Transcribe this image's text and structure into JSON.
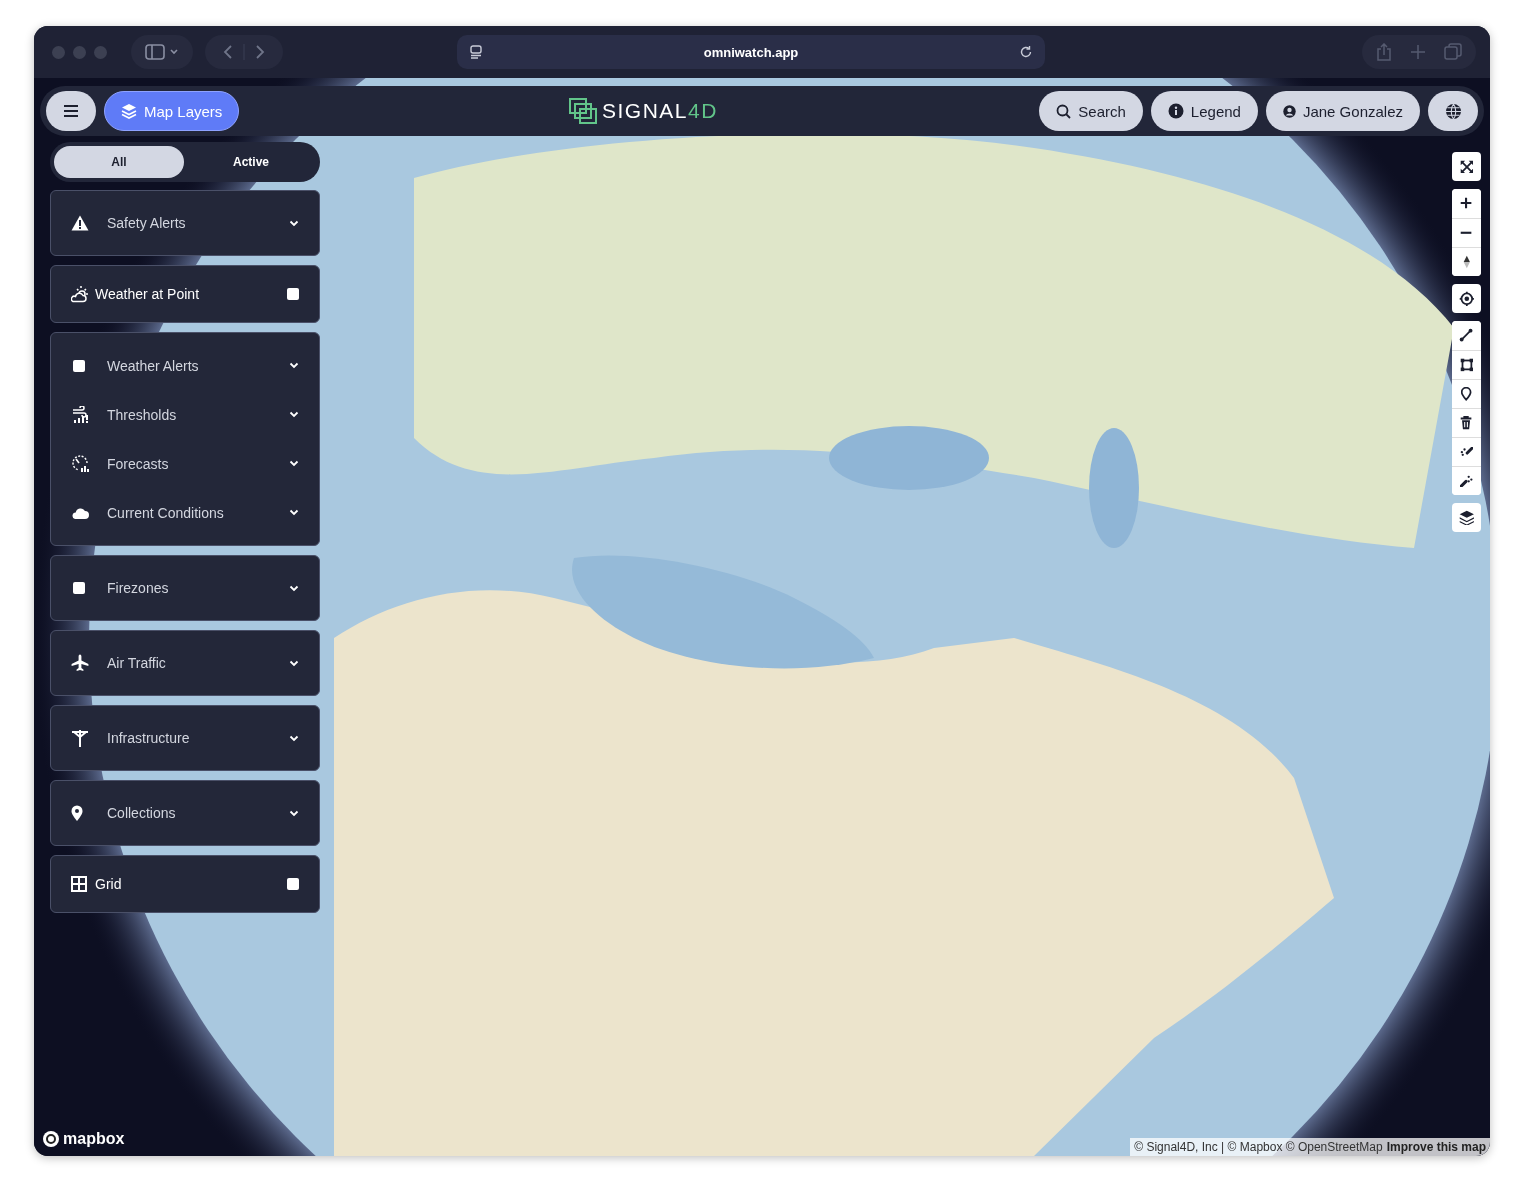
{
  "browser": {
    "url": "omniwatch.app"
  },
  "app_bar": {
    "layers_button": "Map Layers",
    "logo_text": "SIGNAL",
    "logo_accent": "4D",
    "buttons": [
      {
        "kind": "search",
        "label": "Search"
      },
      {
        "kind": "legend",
        "label": "Legend"
      },
      {
        "kind": "user",
        "label": "Jane Gonzalez"
      },
      {
        "kind": "globe"
      }
    ]
  },
  "filter_tabs": [
    {
      "label": "All",
      "selected": true
    },
    {
      "label": "Active",
      "selected": false
    }
  ],
  "layer_groups": [
    {
      "items": [
        {
          "kind": "expand",
          "label": "Safety Alerts"
        }
      ]
    },
    {
      "items": [
        {
          "kind": "toggle",
          "label": "Weather at Point",
          "checked": false
        }
      ]
    },
    {
      "items": [
        {
          "kind": "check-expand",
          "label": "Weather Alerts",
          "checked": false
        },
        {
          "kind": "expand",
          "label": "Thresholds"
        },
        {
          "kind": "expand",
          "label": "Forecasts"
        },
        {
          "kind": "expand",
          "label": "Current Conditions"
        }
      ]
    },
    {
      "items": [
        {
          "kind": "check-expand",
          "label": "Firezones",
          "checked": false
        }
      ]
    },
    {
      "items": [
        {
          "kind": "expand",
          "label": "Air Traffic"
        }
      ]
    },
    {
      "items": [
        {
          "kind": "expand",
          "label": "Infrastructure"
        }
      ]
    },
    {
      "items": [
        {
          "kind": "expand",
          "label": "Collections"
        }
      ]
    },
    {
      "items": [
        {
          "kind": "toggle",
          "label": "Grid",
          "checked": false
        }
      ]
    }
  ],
  "map_footer": {
    "logo": "mapbox",
    "attribution": "© Signal4D, Inc | © Mapbox © OpenStreetMap",
    "improve_link": "Improve this map"
  }
}
